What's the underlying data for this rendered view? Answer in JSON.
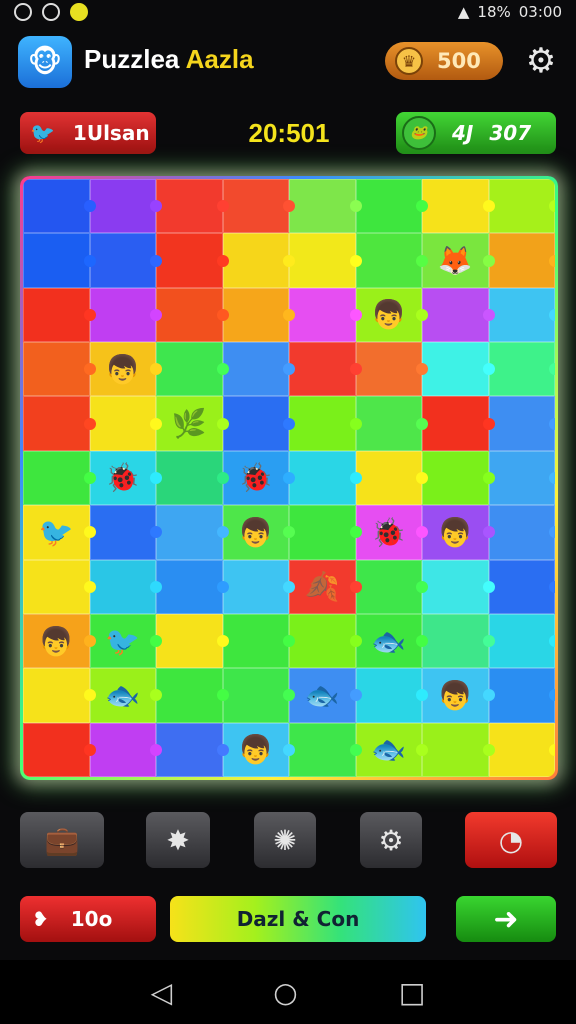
{
  "status_bar": {
    "time": "03:00",
    "battery": "18%"
  },
  "header": {
    "app_icon": "monkey-face-icon",
    "title_word1": "Puzzlea",
    "title_word2": "Aazla",
    "coins": "500",
    "settings_icon": "gear-icon"
  },
  "hud": {
    "left_label": "1Ulsan",
    "timer": "20:501",
    "right_prefix": "4J",
    "right_value": "307"
  },
  "board": {
    "colors": [
      [
        "#2456f0",
        "#8a3cf0",
        "#f23a2d",
        "#f24a2d",
        "#7ee64a",
        "#3ee63e",
        "#f6e21a",
        "#a6f01a"
      ],
      [
        "#1a5ef2",
        "#2a5ef2",
        "#f2351f",
        "#f6d61a",
        "#f2e81a",
        "#4ee63e",
        "#7ae63e",
        "#f2a21a"
      ],
      [
        "#f2301e",
        "#c03ef2",
        "#f2501e",
        "#f6a61a",
        "#e64ef2",
        "#9af01a",
        "#b84ef2",
        "#3ec4f2"
      ],
      [
        "#f2601e",
        "#f6c21a",
        "#3ee64e",
        "#3e8ef2",
        "#f23a2d",
        "#f26e2d",
        "#3ef2e6",
        "#3ef28a"
      ],
      [
        "#f2401e",
        "#f6e21a",
        "#9af01a",
        "#2a6ef2",
        "#7af01a",
        "#4ee64a",
        "#f2301e",
        "#3e8ef2"
      ],
      [
        "#3ee63e",
        "#2ad6e6",
        "#2ad67a",
        "#2a9ef2",
        "#2ad6e6",
        "#f6e21a",
        "#7af01a",
        "#3ea6f2"
      ],
      [
        "#f6e21a",
        "#2a6ef2",
        "#3ea6f2",
        "#4ee64a",
        "#3ee63e",
        "#e64ef2",
        "#9a4ef2",
        "#3e8ef2"
      ],
      [
        "#f6e21a",
        "#2ac6e6",
        "#2a8ef2",
        "#3ec4f2",
        "#f23a2d",
        "#3ee64a",
        "#3ee6e6",
        "#2a6ef2"
      ],
      [
        "#f6a21a",
        "#3ee63e",
        "#f6e21a",
        "#3ee63e",
        "#7af01a",
        "#3ee63e",
        "#3ee68a",
        "#2ad6e6"
      ],
      [
        "#f6e21a",
        "#9af01a",
        "#3ee63e",
        "#3ee64a",
        "#3e8ef2",
        "#2ad6e6",
        "#3ec4f2",
        "#2a8ef2"
      ],
      [
        "#f2301e",
        "#c03ef2",
        "#3e6ef2",
        "#3ec4f2",
        "#3ee64a",
        "#9af01a",
        "#9af01a",
        "#f6e21a"
      ]
    ]
  },
  "controls": {
    "btn1_icon": "briefcase-icon",
    "btn2_icon": "star-burst-icon",
    "btn3_icon": "sparkle-icon",
    "btn4_icon": "gear-icon",
    "btn5_icon": "timer-icon"
  },
  "bottom": {
    "left_label": "10o",
    "center_label": "Dazl & Con",
    "right_icon": "arrow-right-icon"
  },
  "navbar": {
    "back_icon": "back-triangle-icon",
    "home_icon": "home-circle-icon",
    "recent_icon": "recent-square-icon"
  }
}
